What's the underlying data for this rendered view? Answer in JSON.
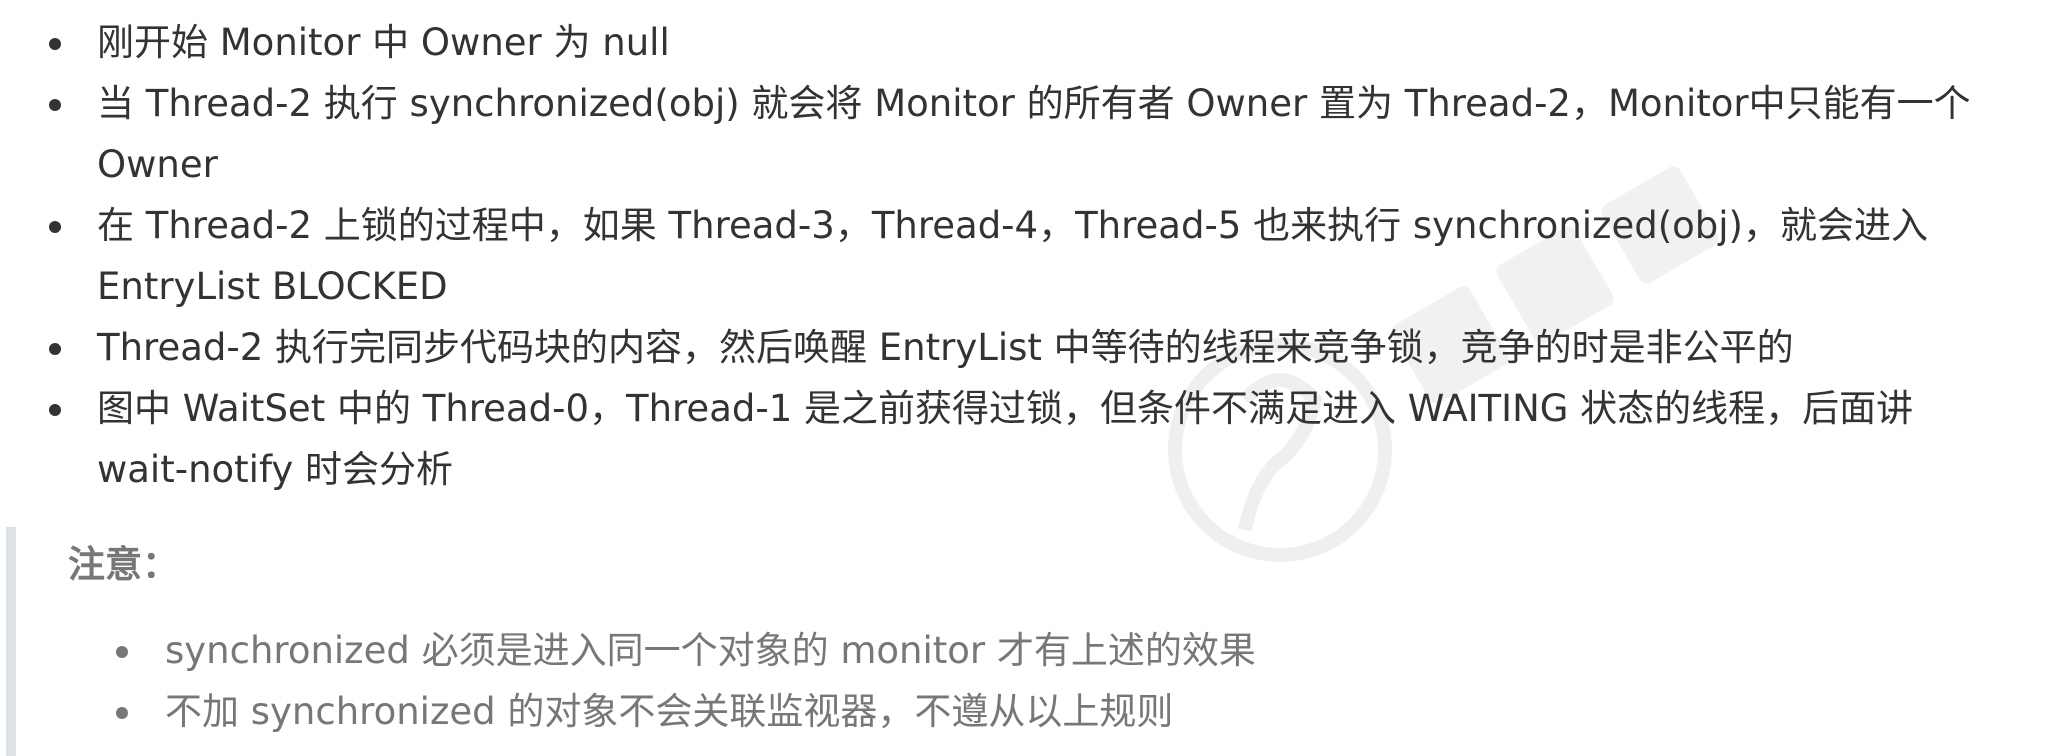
{
  "bullets": [
    "刚开始 Monitor 中 Owner 为 null",
    "当 Thread-2 执行 synchronized(obj) 就会将 Monitor 的所有者 Owner 置为 Thread-2，Monitor中只能有一个 Owner",
    "在 Thread-2 上锁的过程中，如果 Thread-3，Thread-4，Thread-5 也来执行 synchronized(obj)，就会进入 EntryList BLOCKED",
    "Thread-2 执行完同步代码块的内容，然后唤醒 EntryList 中等待的线程来竞争锁，竞争的时是非公平的",
    "图中 WaitSet 中的 Thread-0，Thread-1 是之前获得过锁，但条件不满足进入 WAITING 状态的线程，后面讲 wait-notify 时会分析"
  ],
  "note": {
    "title": "注意：",
    "items": [
      "synchronized 必须是进入同一个对象的 monitor 才有上述的效果",
      "不加 synchronized 的对象不会关联监视器，不遵从以上规则"
    ]
  },
  "watermark": {
    "icon": "brand-logo-icon",
    "color": "#e6e6e6"
  },
  "colors": {
    "text": "#333333",
    "note_text": "#777777",
    "quote_border": "#dfe2e5"
  }
}
